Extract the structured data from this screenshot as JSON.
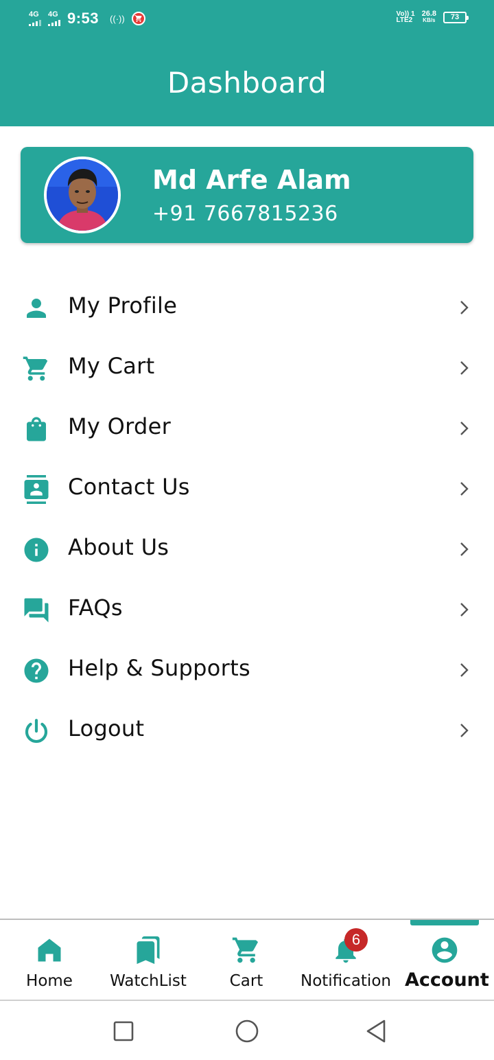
{
  "colors": {
    "accent": "#26A69A",
    "badge": "#C62828",
    "text": "#111111",
    "white": "#FFFFFF"
  },
  "status_bar": {
    "network_1": "4G",
    "network_2": "4G",
    "time": "9:53",
    "volte_line1": "Vo)) 1",
    "volte_line2": "LTE2",
    "speed_value": "26.8",
    "speed_unit": "KB/s",
    "battery": "73"
  },
  "header": {
    "title": "Dashboard"
  },
  "profile": {
    "name": "Md Arfe Alam",
    "phone": "+91 7667815236",
    "avatar_icon": "user-photo"
  },
  "menu": {
    "items": [
      {
        "label": "My Profile",
        "icon": "person-icon"
      },
      {
        "label": "My Cart",
        "icon": "cart-icon"
      },
      {
        "label": "My Order",
        "icon": "shopping-bag-icon"
      },
      {
        "label": "Contact Us",
        "icon": "contact-card-icon"
      },
      {
        "label": "About Us",
        "icon": "info-icon"
      },
      {
        "label": "FAQs",
        "icon": "forum-icon"
      },
      {
        "label": "Help & Supports",
        "icon": "help-icon"
      },
      {
        "label": "Logout",
        "icon": "power-icon"
      }
    ]
  },
  "bottom_nav": {
    "items": [
      {
        "label": "Home",
        "icon": "home-icon"
      },
      {
        "label": "WatchList",
        "icon": "bookmarks-icon"
      },
      {
        "label": "Cart",
        "icon": "cart-icon"
      },
      {
        "label": "Notification",
        "icon": "bell-icon",
        "badge": "6"
      },
      {
        "label": "Account",
        "icon": "account-circle-icon",
        "active": true
      }
    ]
  },
  "system_nav": {
    "buttons": [
      "recents-icon",
      "home-circle-icon",
      "back-icon"
    ]
  }
}
